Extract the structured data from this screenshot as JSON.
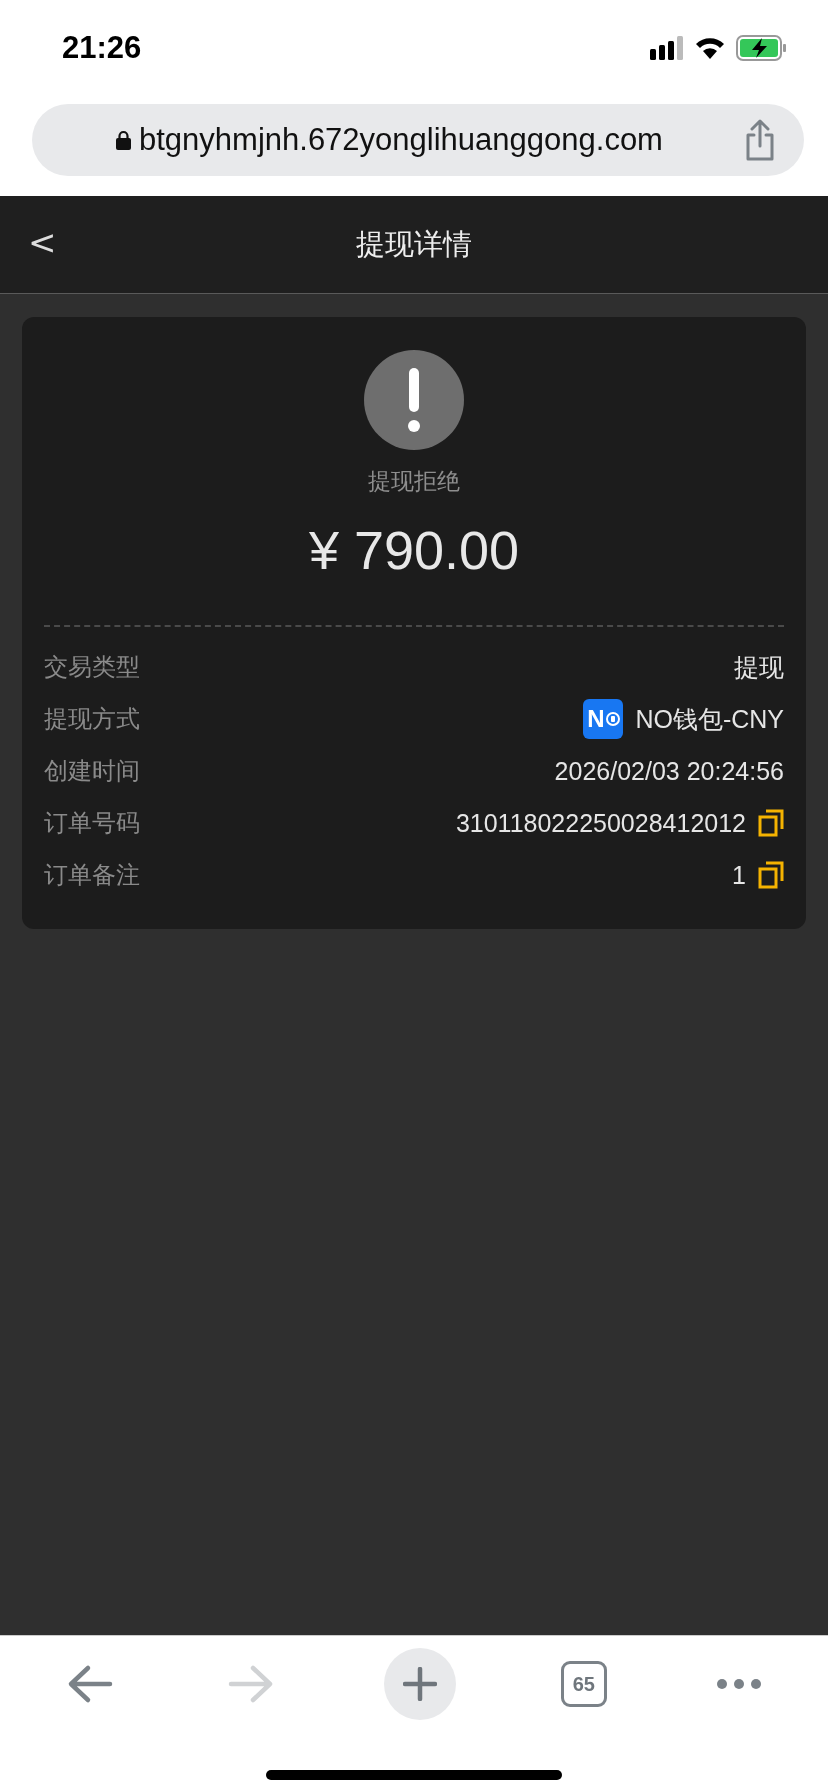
{
  "status_bar": {
    "time": "21:26"
  },
  "browser": {
    "url": "btgnyhmjnh.672yonglihuanggong.com",
    "tab_count": "65",
    "forward_disabled": true,
    "back_disabled": false
  },
  "header": {
    "back": "<",
    "title": "提现详情"
  },
  "card": {
    "status": "提现拒绝",
    "amount": "¥ 790.00",
    "rows": [
      {
        "label": "交易类型",
        "value": "提现",
        "kind": "plain"
      },
      {
        "label": "提现方式",
        "value": "NO钱包-CNY",
        "kind": "logo",
        "logo_text": "N"
      },
      {
        "label": "创建时间",
        "value": "2026/02/03 20:24:56",
        "kind": "plain"
      },
      {
        "label": "订单号码",
        "value": "310118022250028412012",
        "kind": "copy"
      },
      {
        "label": "订单备注",
        "value": "1",
        "kind": "copy"
      }
    ]
  }
}
